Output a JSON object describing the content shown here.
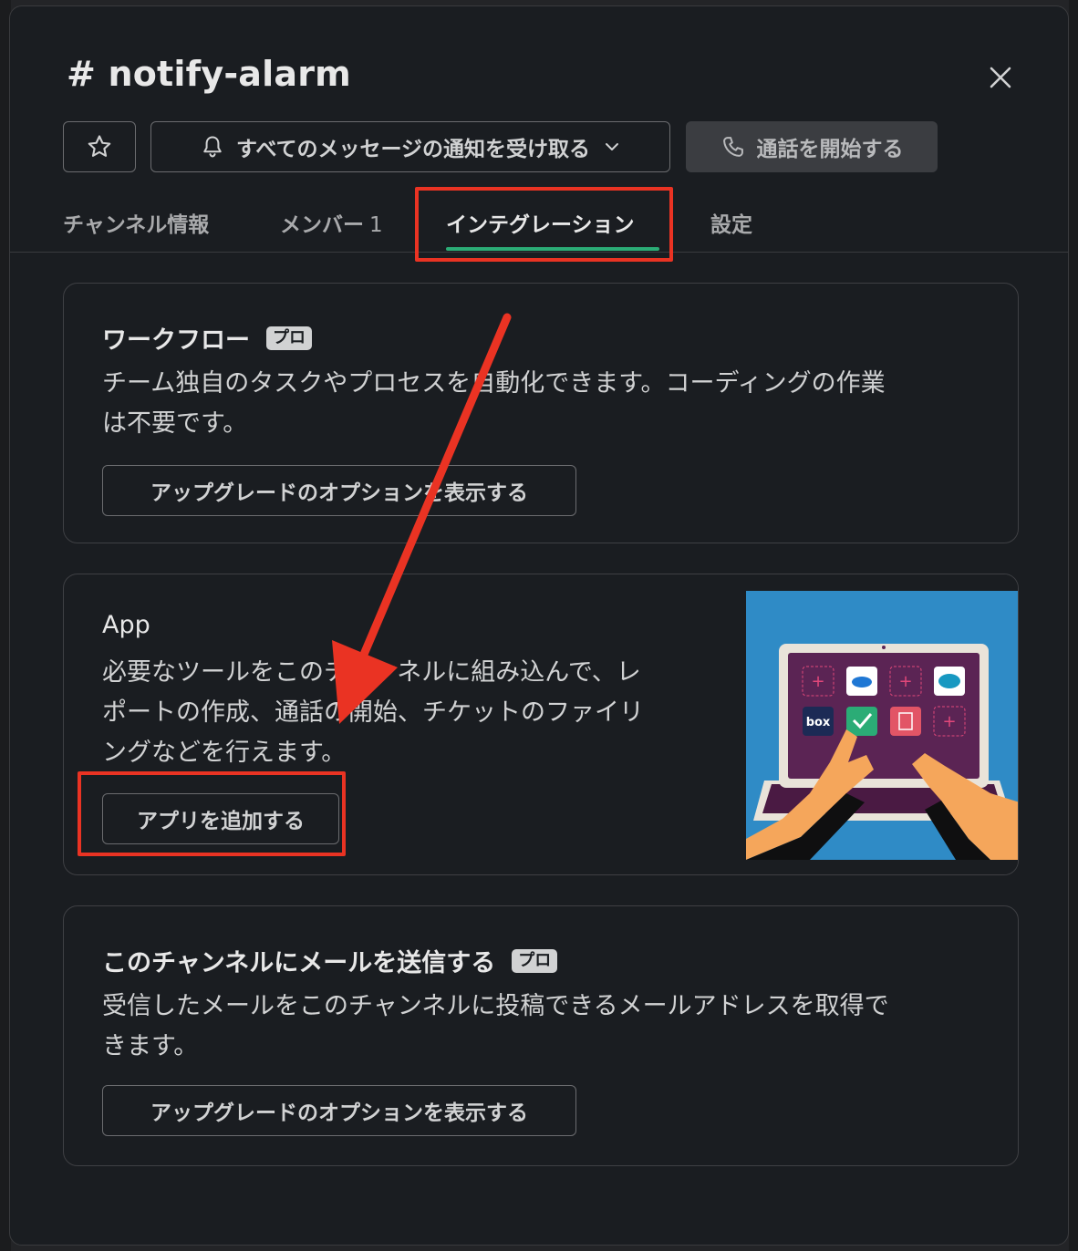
{
  "header": {
    "title": "# notify-alarm",
    "close_icon": "close-icon"
  },
  "toolbar": {
    "star_icon": "star-icon",
    "notify_label": "すべてのメッセージの通知を受け取る",
    "notify_icon": "bell-icon",
    "call_label": "通話を開始する",
    "call_icon": "phone-icon"
  },
  "tabs": [
    {
      "label": "チャンネル情報"
    },
    {
      "label": "メンバー",
      "count": "1"
    },
    {
      "label": "インテグレーション",
      "active": true
    },
    {
      "label": "設定"
    }
  ],
  "workflow": {
    "title": "ワークフロー",
    "badge": "プロ",
    "desc_line1": "チーム独自のタスクやプロセスを自動化できます。コーディングの作業",
    "desc_line2": "は不要です。",
    "button": "アップグレードのオプションを表示する"
  },
  "app": {
    "title": "App",
    "desc_line1": "必要なツールをこのチャンネルに組み込んで、レ",
    "desc_line2": "ポートの作成、通話の開始、チケットのファイリ",
    "desc_line3": "ングなどを行えます。",
    "button": "アプリを追加する",
    "illustration": "laptop-apps-illustration"
  },
  "email": {
    "title": "このチャンネルにメールを送信する",
    "badge": "プロ",
    "desc_line1": "受信したメールをこのチャンネルに投稿できるメールアドレスを取得で",
    "desc_line2": "きます。",
    "button": "アップグレードのオプションを表示する"
  },
  "colors": {
    "modal_bg": "#1a1d21",
    "accent_green": "#2bac76",
    "annotation_red": "#ea3323"
  }
}
